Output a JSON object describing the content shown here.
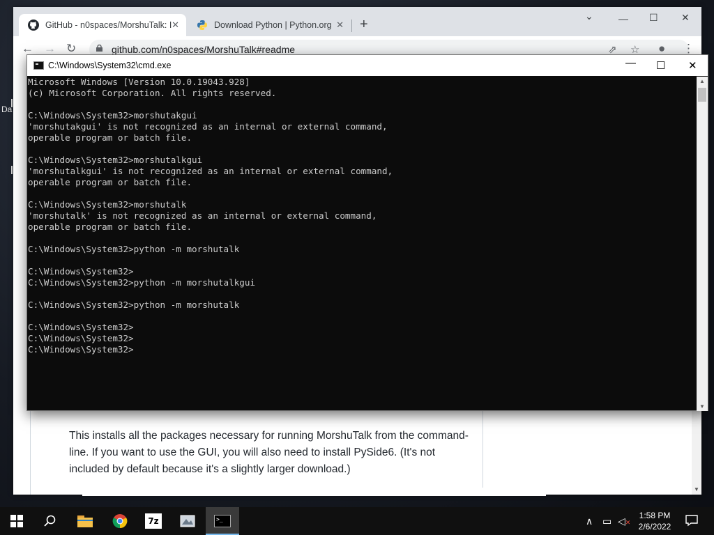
{
  "browser": {
    "tabs": [
      {
        "title": "GitHub - n0spaces/MorshuTalk: I",
        "active": true
      },
      {
        "title": "Download Python | Python.org",
        "active": false
      }
    ],
    "url": "github.com/n0spaces/MorshuTalk#readme",
    "readme_text": "This installs all the packages necessary for running MorshuTalk from the command-line. If you want to use the GUI, you will also need to install PySide6. (It's not included by default because it's a slightly larger download.)"
  },
  "desktop": {
    "edge_text": "Da"
  },
  "cmd": {
    "title": "C:\\Windows\\System32\\cmd.exe",
    "output": "Microsoft Windows [Version 10.0.19043.928]\n(c) Microsoft Corporation. All rights reserved.\n\nC:\\Windows\\System32>morshutakgui\n'morshutakgui' is not recognized as an internal or external command,\noperable program or batch file.\n\nC:\\Windows\\System32>morshutalkgui\n'morshutalkgui' is not recognized as an internal or external command,\noperable program or batch file.\n\nC:\\Windows\\System32>morshutalk\n'morshutalk' is not recognized as an internal or external command,\noperable program or batch file.\n\nC:\\Windows\\System32>python -m morshutalk\n\nC:\\Windows\\System32>\nC:\\Windows\\System32>python -m morshutalkgui\n\nC:\\Windows\\System32>python -m morshutalk\n\nC:\\Windows\\System32>\nC:\\Windows\\System32>\nC:\\Windows\\System32>"
  },
  "taskbar": {
    "items": [
      "start-icon",
      "search-icon",
      "file-explorer-icon",
      "chrome-icon",
      "7zip-icon",
      "app-icon",
      "cmd-icon"
    ],
    "time": "1:58 PM",
    "date": "2/6/2022"
  },
  "colors": {
    "console_bg": "#0c0c0c",
    "console_fg": "#cccccc",
    "taskbar_bg": "#101010",
    "tabstrip_bg": "#dee1e6"
  }
}
